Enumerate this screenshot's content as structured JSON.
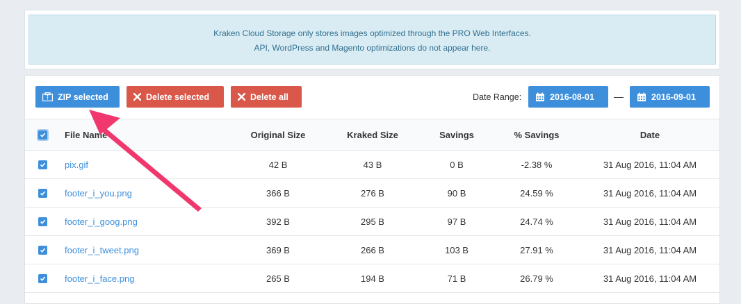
{
  "notice": {
    "line1": "Kraken Cloud Storage only stores images optimized through the PRO Web Interfaces.",
    "line2": "API, WordPress and Magento optimizations do not appear here."
  },
  "toolbar": {
    "zip_label": "ZIP selected",
    "delete_selected_label": "Delete selected",
    "delete_all_label": "Delete all",
    "date_range_label": "Date Range:",
    "date_from": "2016-08-01",
    "date_separator": "—",
    "date_to": "2016-09-01"
  },
  "table": {
    "headers": {
      "file_name": "File Name",
      "original_size": "Original Size",
      "kraked_size": "Kraked Size",
      "savings": "Savings",
      "pct_savings": "% Savings",
      "date": "Date"
    },
    "rows": [
      {
        "file": "pix.gif",
        "original": "42 B",
        "kraked": "43 B",
        "savings": "0 B",
        "pct": "-2.38 %",
        "date": "31 Aug 2016, 11:04 AM",
        "checked": true
      },
      {
        "file": "footer_i_you.png",
        "original": "366 B",
        "kraked": "276 B",
        "savings": "90 B",
        "pct": "24.59 %",
        "date": "31 Aug 2016, 11:04 AM",
        "checked": true
      },
      {
        "file": "footer_i_goog.png",
        "original": "392 B",
        "kraked": "295 B",
        "savings": "97 B",
        "pct": "24.74 %",
        "date": "31 Aug 2016, 11:04 AM",
        "checked": true
      },
      {
        "file": "footer_i_tweet.png",
        "original": "369 B",
        "kraked": "266 B",
        "savings": "103 B",
        "pct": "27.91 %",
        "date": "31 Aug 2016, 11:04 AM",
        "checked": true
      },
      {
        "file": "footer_i_face.png",
        "original": "265 B",
        "kraked": "194 B",
        "savings": "71 B",
        "pct": "26.79 %",
        "date": "31 Aug 2016, 11:04 AM",
        "checked": true
      }
    ]
  },
  "colors": {
    "accent_blue": "#3d8fdc",
    "danger_red": "#d9584a",
    "annotation_arrow": "#f0386f"
  }
}
